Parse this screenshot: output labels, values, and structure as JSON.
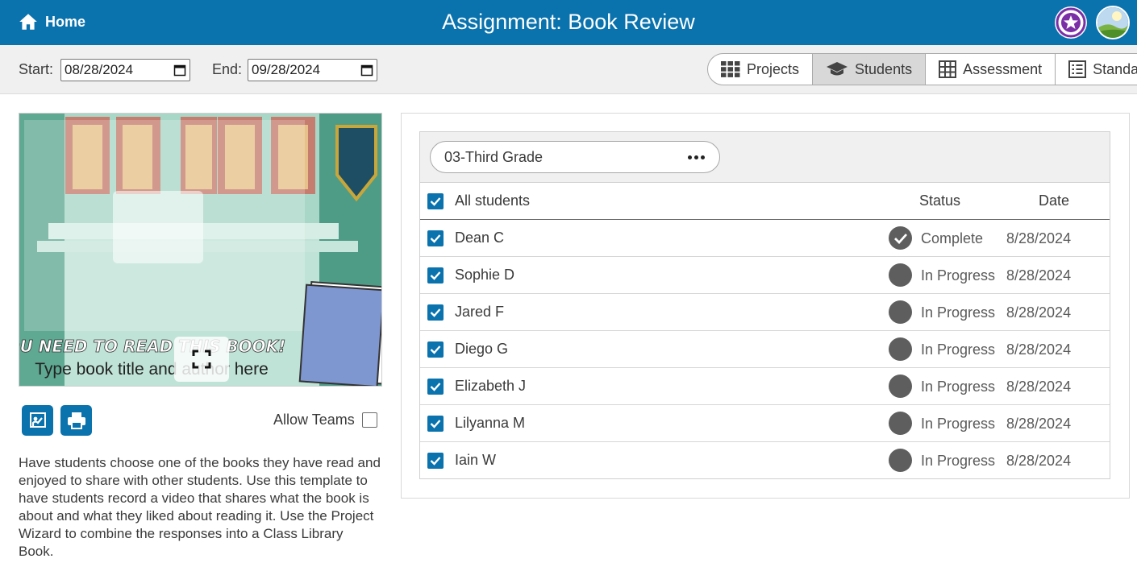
{
  "header": {
    "home_label": "Home",
    "title": "Assignment: Book Review"
  },
  "toolbar": {
    "start_label": "Start:",
    "start_value": "08/28/2024",
    "end_label": "End:",
    "end_value": "09/28/2024",
    "tabs": [
      {
        "label": "Projects",
        "icon": "grid-icon"
      },
      {
        "label": "Students",
        "icon": "graduation-cap-icon",
        "active": true
      },
      {
        "label": "Assessment",
        "icon": "table-icon"
      },
      {
        "label": "Standards",
        "icon": "list-icon"
      }
    ]
  },
  "preview": {
    "headline": "YOU NEED TO READ THIS BOOK!",
    "subline": "Type book title and author here"
  },
  "left": {
    "allow_teams_label": "Allow Teams",
    "allow_teams_checked": false,
    "description": "Have students choose one of the books they have read and enjoyed to share with other students. Use this template to have students record a video that shares what the book is about and what they liked about reading it. Use the Project Wizard to combine the responses into a Class Library Book."
  },
  "roster": {
    "class_name": "03-Third Grade",
    "header": {
      "all_label": "All students",
      "status_label": "Status",
      "date_label": "Date"
    },
    "students": [
      {
        "name": "Dean C",
        "status": "Complete",
        "date": "8/28/2024"
      },
      {
        "name": "Sophie D",
        "status": "In Progress",
        "date": "8/28/2024"
      },
      {
        "name": "Jared F",
        "status": "In Progress",
        "date": "8/28/2024"
      },
      {
        "name": "Diego G",
        "status": "In Progress",
        "date": "8/28/2024"
      },
      {
        "name": "Elizabeth J",
        "status": "In Progress",
        "date": "8/28/2024"
      },
      {
        "name": "Lilyanna M",
        "status": "In Progress",
        "date": "8/28/2024"
      },
      {
        "name": "Iain W",
        "status": "In Progress",
        "date": "8/28/2024"
      }
    ]
  },
  "colors": {
    "brand": "#0a72ad",
    "toolbar_bg": "#f0f0f0",
    "status_dot": "#5e5e5e",
    "badge": "#7b2fa6"
  }
}
